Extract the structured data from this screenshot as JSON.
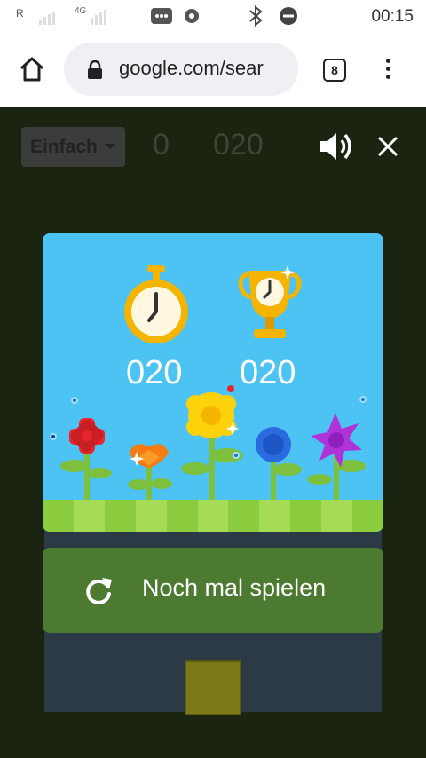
{
  "status_bar": {
    "carrier": "R",
    "network": "4G",
    "time": "00:15"
  },
  "browser": {
    "url_display": "google.com/sear",
    "tab_count": "8"
  },
  "game": {
    "difficulty": "Einfach",
    "score": "0",
    "timer": "020",
    "result": {
      "time_value": "020",
      "best_value": "020"
    },
    "play_again_label": "Noch mal spielen"
  },
  "colors": {
    "panel_sky": "#4dc3f4",
    "play_button": "#4b7a30",
    "game_background": "#1b2410"
  }
}
